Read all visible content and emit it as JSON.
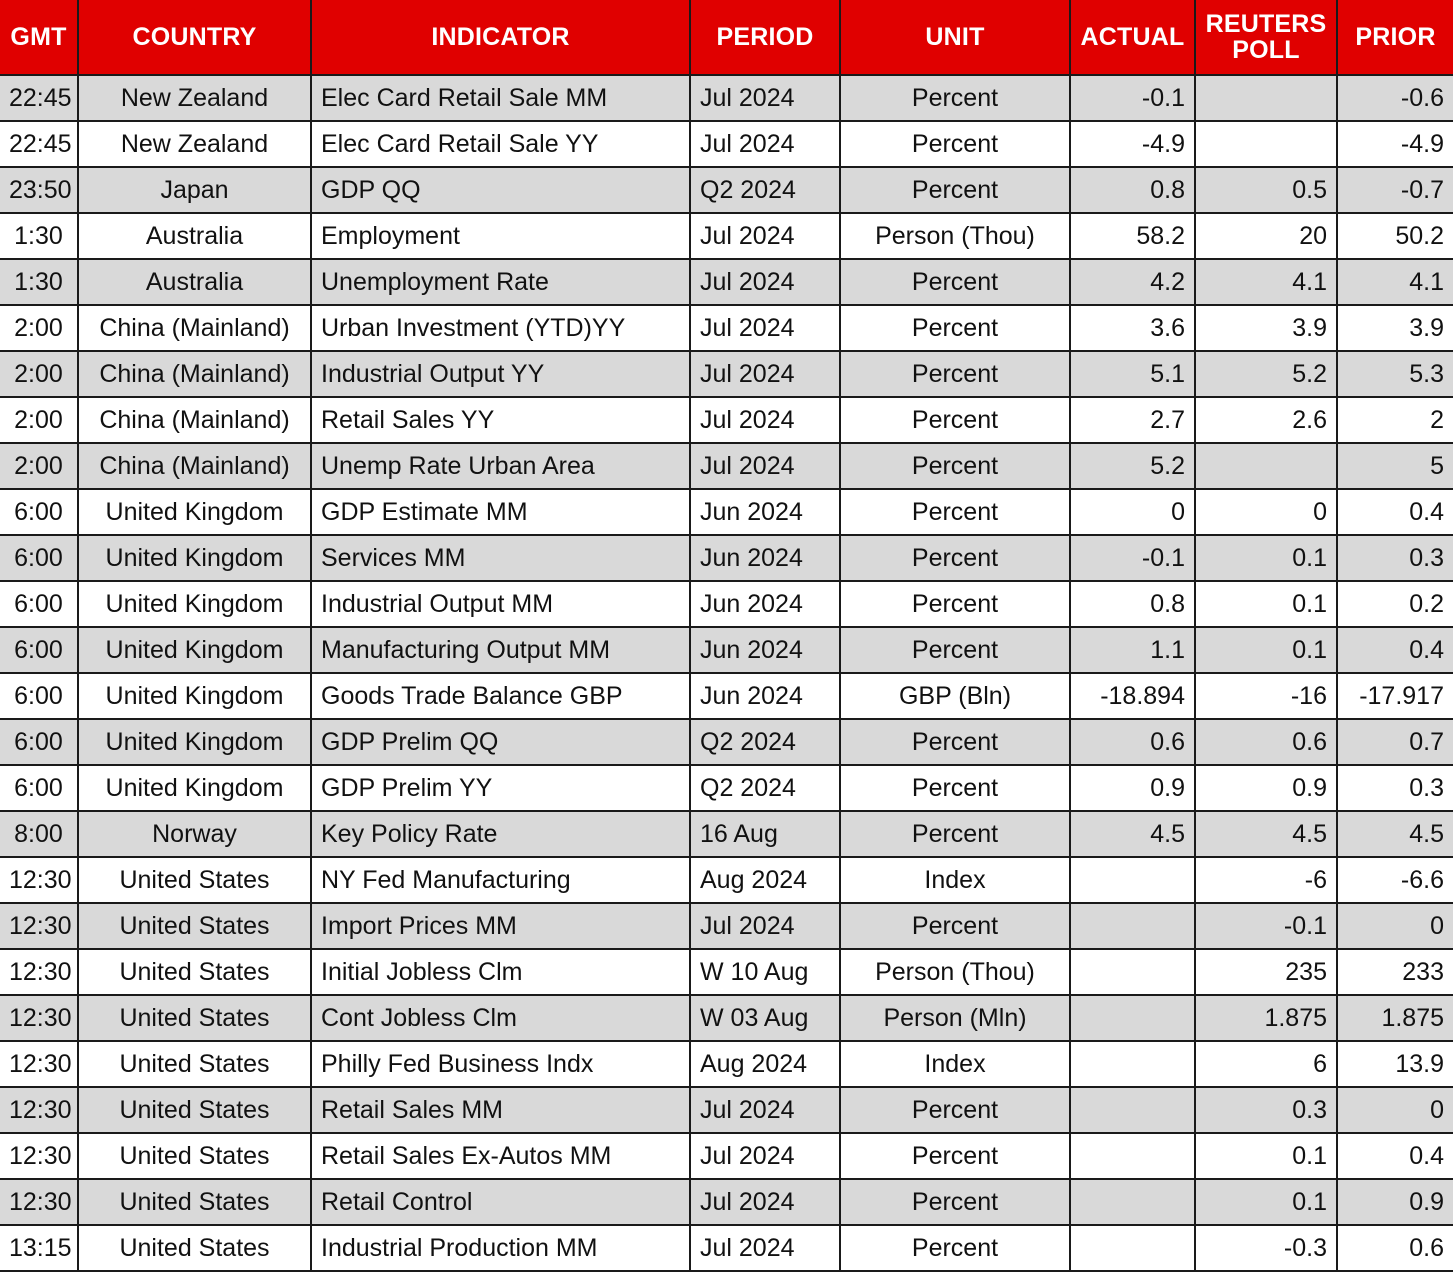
{
  "table": {
    "name": "economic-indicator-calendar",
    "header_bg": "#E00000",
    "header_text_color": "#FFFFFF",
    "row_shade_color": "#D9D9D9",
    "row_plain_color": "#FFFFFF",
    "grid_color": "#1A1A1A",
    "columns": [
      {
        "key": "gmt",
        "label": "GMT",
        "align": "center"
      },
      {
        "key": "country",
        "label": "COUNTRY",
        "align": "center"
      },
      {
        "key": "indicator",
        "label": "INDICATOR",
        "align": "left"
      },
      {
        "key": "period",
        "label": "PERIOD",
        "align": "left"
      },
      {
        "key": "unit",
        "label": "UNIT",
        "align": "center"
      },
      {
        "key": "actual",
        "label": "ACTUAL",
        "align": "right"
      },
      {
        "key": "poll",
        "label": "REUTERS POLL",
        "align": "right"
      },
      {
        "key": "prior",
        "label": "PRIOR",
        "align": "right"
      }
    ],
    "rows": [
      {
        "gmt": "22:45",
        "country": "New Zealand",
        "indicator": "Elec Card Retail Sale MM",
        "period": "Jul 2024",
        "unit": "Percent",
        "actual": "-0.1",
        "poll": "",
        "prior": "-0.6"
      },
      {
        "gmt": "22:45",
        "country": "New Zealand",
        "indicator": "Elec Card Retail Sale YY",
        "period": "Jul 2024",
        "unit": "Percent",
        "actual": "-4.9",
        "poll": "",
        "prior": "-4.9"
      },
      {
        "gmt": "23:50",
        "country": "Japan",
        "indicator": "GDP QQ",
        "period": "Q2 2024",
        "unit": "Percent",
        "actual": "0.8",
        "poll": "0.5",
        "prior": "-0.7"
      },
      {
        "gmt": "1:30",
        "country": "Australia",
        "indicator": "Employment",
        "period": "Jul 2024",
        "unit": "Person (Thou)",
        "actual": "58.2",
        "poll": "20",
        "prior": "50.2"
      },
      {
        "gmt": "1:30",
        "country": "Australia",
        "indicator": "Unemployment Rate",
        "period": "Jul 2024",
        "unit": "Percent",
        "actual": "4.2",
        "poll": "4.1",
        "prior": "4.1"
      },
      {
        "gmt": "2:00",
        "country": "China (Mainland)",
        "indicator": "Urban Investment (YTD)YY",
        "period": "Jul 2024",
        "unit": "Percent",
        "actual": "3.6",
        "poll": "3.9",
        "prior": "3.9"
      },
      {
        "gmt": "2:00",
        "country": "China (Mainland)",
        "indicator": "Industrial Output YY",
        "period": "Jul 2024",
        "unit": "Percent",
        "actual": "5.1",
        "poll": "5.2",
        "prior": "5.3"
      },
      {
        "gmt": "2:00",
        "country": "China (Mainland)",
        "indicator": "Retail Sales YY",
        "period": "Jul 2024",
        "unit": "Percent",
        "actual": "2.7",
        "poll": "2.6",
        "prior": "2"
      },
      {
        "gmt": "2:00",
        "country": "China (Mainland)",
        "indicator": "Unemp Rate Urban Area",
        "period": "Jul 2024",
        "unit": "Percent",
        "actual": "5.2",
        "poll": "",
        "prior": "5"
      },
      {
        "gmt": "6:00",
        "country": "United Kingdom",
        "indicator": "GDP Estimate MM",
        "period": "Jun 2024",
        "unit": "Percent",
        "actual": "0",
        "poll": "0",
        "prior": "0.4"
      },
      {
        "gmt": "6:00",
        "country": "United Kingdom",
        "indicator": "Services MM",
        "period": "Jun 2024",
        "unit": "Percent",
        "actual": "-0.1",
        "poll": "0.1",
        "prior": "0.3"
      },
      {
        "gmt": "6:00",
        "country": "United Kingdom",
        "indicator": "Industrial Output MM",
        "period": "Jun 2024",
        "unit": "Percent",
        "actual": "0.8",
        "poll": "0.1",
        "prior": "0.2"
      },
      {
        "gmt": "6:00",
        "country": "United Kingdom",
        "indicator": "Manufacturing Output MM",
        "period": "Jun 2024",
        "unit": "Percent",
        "actual": "1.1",
        "poll": "0.1",
        "prior": "0.4"
      },
      {
        "gmt": "6:00",
        "country": "United Kingdom",
        "indicator": "Goods Trade Balance GBP",
        "period": "Jun 2024",
        "unit": "GBP (Bln)",
        "actual": "-18.894",
        "poll": "-16",
        "prior": "-17.917"
      },
      {
        "gmt": "6:00",
        "country": "United Kingdom",
        "indicator": "GDP Prelim QQ",
        "period": "Q2 2024",
        "unit": "Percent",
        "actual": "0.6",
        "poll": "0.6",
        "prior": "0.7"
      },
      {
        "gmt": "6:00",
        "country": "United Kingdom",
        "indicator": "GDP Prelim YY",
        "period": "Q2 2024",
        "unit": "Percent",
        "actual": "0.9",
        "poll": "0.9",
        "prior": "0.3"
      },
      {
        "gmt": "8:00",
        "country": "Norway",
        "indicator": "Key Policy Rate",
        "period": "16 Aug",
        "unit": "Percent",
        "actual": "4.5",
        "poll": "4.5",
        "prior": "4.5"
      },
      {
        "gmt": "12:30",
        "country": "United States",
        "indicator": "NY Fed Manufacturing",
        "period": "Aug 2024",
        "unit": "Index",
        "actual": "",
        "poll": "-6",
        "prior": "-6.6"
      },
      {
        "gmt": "12:30",
        "country": "United States",
        "indicator": "Import Prices MM",
        "period": "Jul 2024",
        "unit": "Percent",
        "actual": "",
        "poll": "-0.1",
        "prior": "0"
      },
      {
        "gmt": "12:30",
        "country": "United States",
        "indicator": "Initial Jobless Clm",
        "period": "W 10 Aug",
        "unit": "Person (Thou)",
        "actual": "",
        "poll": "235",
        "prior": "233"
      },
      {
        "gmt": "12:30",
        "country": "United States",
        "indicator": "Cont Jobless Clm",
        "period": "W 03 Aug",
        "unit": "Person (Mln)",
        "actual": "",
        "poll": "1.875",
        "prior": "1.875"
      },
      {
        "gmt": "12:30",
        "country": "United States",
        "indicator": "Philly Fed Business Indx",
        "period": "Aug 2024",
        "unit": "Index",
        "actual": "",
        "poll": "6",
        "prior": "13.9"
      },
      {
        "gmt": "12:30",
        "country": "United States",
        "indicator": "Retail Sales MM",
        "period": "Jul 2024",
        "unit": "Percent",
        "actual": "",
        "poll": "0.3",
        "prior": "0"
      },
      {
        "gmt": "12:30",
        "country": "United States",
        "indicator": "Retail Sales Ex-Autos MM",
        "period": "Jul 2024",
        "unit": "Percent",
        "actual": "",
        "poll": "0.1",
        "prior": "0.4"
      },
      {
        "gmt": "12:30",
        "country": "United States",
        "indicator": "Retail Control",
        "period": "Jul 2024",
        "unit": "Percent",
        "actual": "",
        "poll": "0.1",
        "prior": "0.9"
      },
      {
        "gmt": "13:15",
        "country": "United States",
        "indicator": "Industrial Production MM",
        "period": "Jul 2024",
        "unit": "Percent",
        "actual": "",
        "poll": "-0.3",
        "prior": "0.6"
      }
    ]
  }
}
